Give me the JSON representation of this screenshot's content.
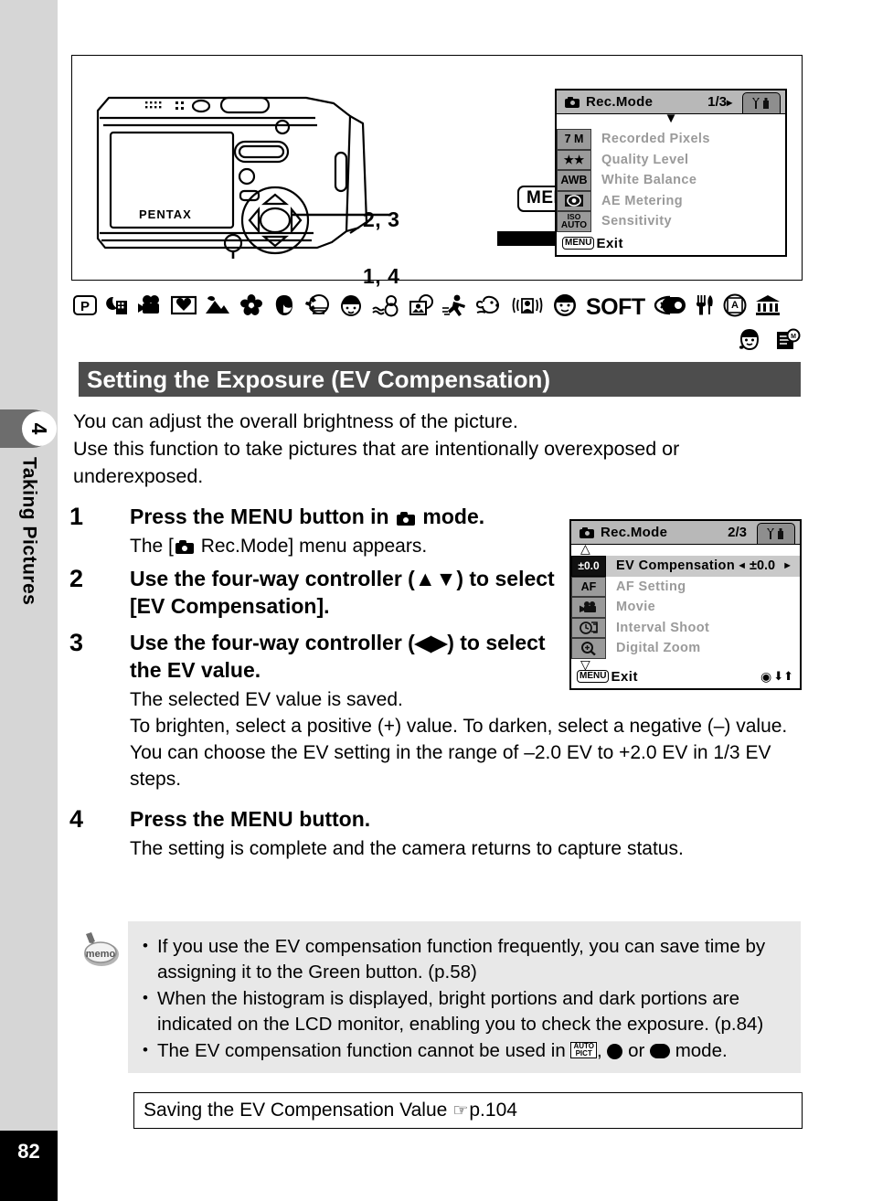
{
  "page": {
    "number": "82",
    "chapter_number": "4",
    "chapter_title": "Taking Pictures"
  },
  "figure": {
    "menu_button_label": "MENU",
    "callout_upper": "2, 3",
    "callout_lower": "1, 4",
    "camera_brand": "PENTAX"
  },
  "lcd_screen_1": {
    "title": "Rec.Mode",
    "page_indicator": "1/3",
    "tab_icon": "wrench-setup-icon",
    "rows": [
      {
        "icon_text": "7 M",
        "label": "Recorded Pixels"
      },
      {
        "icon_text": "★★",
        "label": "Quality Level"
      },
      {
        "icon_text": "AWB",
        "label": "White Balance"
      },
      {
        "icon_text": "AE",
        "label": "AE Metering"
      },
      {
        "icon_text": "ISO AUTO",
        "label": "Sensitivity"
      }
    ],
    "footer_chip": "MENU",
    "footer_label": "Exit"
  },
  "lcd_screen_2": {
    "title": "Rec.Mode",
    "page_indicator": "2/3",
    "tab_icon": "wrench-setup-icon",
    "rows": [
      {
        "icon_text": "±0.0",
        "label": "EV Compensation",
        "value": "±0.0",
        "selected": true
      },
      {
        "icon_text": "AF",
        "label": "AF Setting"
      },
      {
        "icon_text": "movie",
        "label": "Movie"
      },
      {
        "icon_text": "interval",
        "label": "Interval Shoot"
      },
      {
        "icon_text": "zoom",
        "label": "Digital Zoom"
      }
    ],
    "footer_chip": "MENU",
    "footer_label": "Exit"
  },
  "mode_icons": {
    "row1": [
      "program-mode-icon",
      "night-scene-icon",
      "movie-icon",
      "frame-composite-icon",
      "landscape-icon",
      "flower-icon",
      "portrait-icon",
      "surf-snow-icon",
      "sport-kids-icon",
      "pet-snowman-icon",
      "text-frame-icon",
      "sport-running-icon",
      "pet-dog-icon",
      "self-portrait-icon",
      "half-length-portrait-icon",
      "soft-icon",
      "sticker-icon",
      "food-icon",
      "text-icon",
      "museum-icon"
    ],
    "row2": [
      "kids-icon",
      "report-icon"
    ],
    "soft_label": "SOFT",
    "program_label": "P"
  },
  "heading": "Setting the Exposure (EV Compensation)",
  "intro": [
    "You can adjust the overall brightness of the picture.",
    "Use this function to take pictures that are intentionally overexposed or underexposed."
  ],
  "steps": [
    {
      "num": "1",
      "head_pre": "Press the ",
      "head_menu": "MENU",
      "head_mid": " button in ",
      "head_post": " mode.",
      "body_pre": "The [",
      "body_post": " Rec.Mode] menu appears."
    },
    {
      "num": "2",
      "head": "Use the four-way controller (▲▼) to select [EV Compensation]."
    },
    {
      "num": "3",
      "head": "Use the four-way controller (◀▶) to select the EV value.",
      "body": [
        "The selected EV value is saved.",
        "To brighten, select a positive (+) value. To darken, select a negative (–) value.",
        "You can choose the EV setting in the range of –2.0 EV to +2.0 EV in 1/3 EV steps."
      ]
    },
    {
      "num": "4",
      "head_pre": "Press the ",
      "head_menu": "MENU",
      "head_post": " button.",
      "body": "The setting is complete and the camera returns to capture status."
    }
  ],
  "memo": {
    "icon_label": "memo",
    "items": [
      "If you use the EV compensation function frequently, you can save time by assigning it to the Green button. (p.58)",
      "When the histogram is displayed, bright portions and dark portions are indicated on the LCD monitor, enabling you to check the exposure. (p.84)"
    ],
    "last_item_pre": "The EV compensation function cannot be used in ",
    "last_item_auto": "AUTO PICT",
    "last_item_mid": ", ",
    "last_item_or": " or ",
    "last_item_post": " mode."
  },
  "reference": {
    "text": "Saving the EV Compensation Value",
    "pointer": "☞",
    "page": "p.104"
  },
  "colors": {
    "rail_bg": "#d6d6d6",
    "rail_tab": "#6d6d6d",
    "heading_bg": "#4d4d4d",
    "memo_bg": "#e8e8e8",
    "lcd_titlebar": "#b8b8b8",
    "lcd_icon_box": "#9a9a9a",
    "lcd_highlight": "#c9c9c9"
  }
}
